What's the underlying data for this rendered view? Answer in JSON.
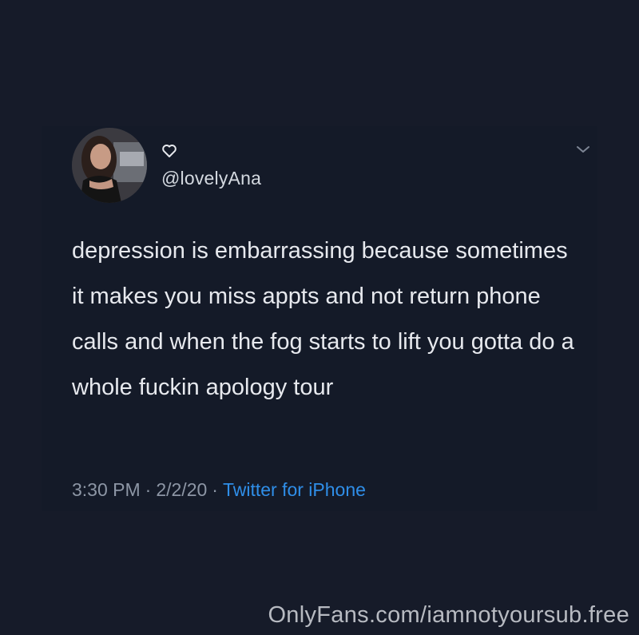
{
  "tweet": {
    "avatar_icon": "user-avatar-photo",
    "badge_icon": "heart-outline-icon",
    "handle": "@lovelyAna",
    "menu_icon": "chevron-down-icon",
    "text": "depression is embarrassing because sometimes it makes you miss appts and not return phone calls and when the fog starts to lift you gotta do a whole fuckin apology tour",
    "time": "3:30 PM",
    "separator": "·",
    "date": "2/2/20",
    "source": "Twitter for iPhone"
  },
  "watermark": "OnlyFans.com/iamnotyoursub.free",
  "colors": {
    "background": "#161b29",
    "text": "#e7e9ee",
    "meta": "#8d96a5",
    "link": "#2f8ee8"
  }
}
